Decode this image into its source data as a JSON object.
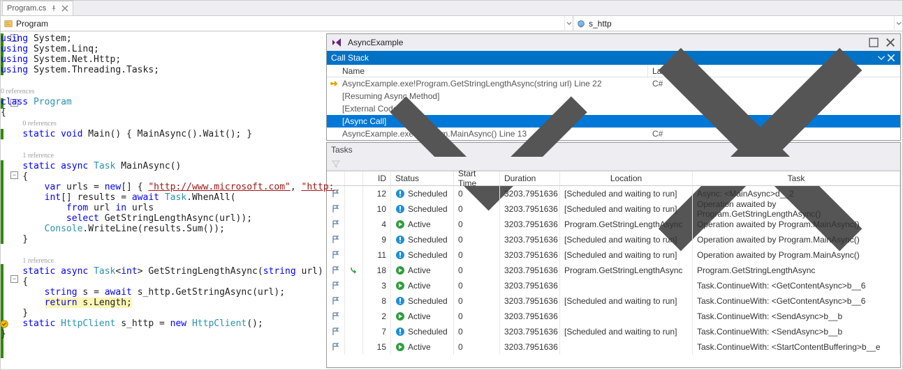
{
  "tab": {
    "title": "Program.cs"
  },
  "navbar": {
    "left": "Program",
    "right": "s_http"
  },
  "code": {
    "lines": [
      {
        "t": "using ",
        "k": true,
        "r": "System;"
      },
      {
        "t": "using ",
        "k": true,
        "r": "System.Linq;"
      },
      {
        "t": "using ",
        "k": true,
        "r": "System.Net.Http;"
      },
      {
        "t": "using ",
        "k": true,
        "r": "System.Threading.Tasks;"
      }
    ],
    "lens0": "0 references",
    "class_decl_kw": "class ",
    "class_decl_name": "Program",
    "lens1": "0 references",
    "main_sig_pre": "static void ",
    "main_sig_name": "Main() { MainAsync().Wait(); }",
    "lens2": "1 reference",
    "mainasync_pre": "static async ",
    "mainasync_type": "Task ",
    "mainasync_name": "MainAsync()",
    "urls_pre": "var ",
    "urls_mid": "urls = ",
    "urls_new": "new",
    "urls_rest": "[] { ",
    "url1": "\"http://www.microsoft.com\"",
    "urls_sep": ", ",
    "url2": "\"http:",
    "results_pre": "int",
    "results_mid": "[] results = ",
    "results_await": "await ",
    "results_type": "Task",
    "results_rest": ".WhenAll(",
    "from_pre": "from ",
    "from_mid": "url ",
    "from_in": "in ",
    "from_rest": "urls",
    "select_pre": "select ",
    "select_rest": "GetStringLengthAsync(url));",
    "console_type": "Console",
    "console_rest": ".WriteLine(results.Sum());",
    "lens3": "1 reference",
    "gsla_pre": "static async ",
    "gsla_type": "Task",
    "gsla_generic": "<",
    "gsla_int": "int",
    "gsla_rest": "> GetStringLengthAsync(",
    "gsla_str": "string ",
    "gsla_tail": "url)",
    "s_pre": "string ",
    "s_mid": "s = ",
    "s_await": "await ",
    "s_rest": "s_http.GetStringAsync(url);",
    "return_kw": "return ",
    "return_rest": "s.Length;",
    "httpclient_pre": "static ",
    "httpclient_type": "HttpClient ",
    "httpclient_mid": "s_http = ",
    "httpclient_new": "new ",
    "httpclient_type2": "HttpClient",
    "httpclient_rest": "();"
  },
  "asyncWindow": {
    "title": "AsyncExample",
    "callstack_title": "Call Stack",
    "col_name": "Name",
    "col_lang": "Language",
    "rows": [
      {
        "icon": "arrow",
        "name": "AsyncExample.exe!Program.GetStringLengthAsync(string url) Line 22",
        "lang": "C#"
      },
      {
        "icon": "",
        "name": "[Resuming Async Method]",
        "lang": ""
      },
      {
        "icon": "",
        "name": "[External Code]",
        "lang": ""
      },
      {
        "icon": "",
        "name": "[Async Call]",
        "lang": "",
        "sel": true
      },
      {
        "icon": "",
        "name": "AsyncExample.exe!Program.MainAsync() Line 13",
        "lang": "C#"
      }
    ]
  },
  "tasks": {
    "title": "Tasks",
    "cols": {
      "id": "ID",
      "status": "Status",
      "start": "Start Time",
      "dur": "Duration",
      "loc": "Location",
      "task": "Task"
    },
    "rows": [
      {
        "id": "12",
        "status": "Scheduled",
        "sicon": "sched",
        "start": "0",
        "dur": "3203.7951636",
        "loc": "[Scheduled and waiting to run]",
        "task": "Async: <MainAsync>d__2"
      },
      {
        "id": "10",
        "status": "Scheduled",
        "sicon": "sched",
        "start": "0",
        "dur": "3203.7951636",
        "loc": "[Scheduled and waiting to run]",
        "task": "Operation awaited by Program.GetStringLengthAsync()"
      },
      {
        "id": "4",
        "status": "Active",
        "sicon": "active",
        "start": "0",
        "dur": "3203.7951636",
        "loc": "Program.GetStringLengthAsync",
        "task": "Operation awaited by Program.MainAsync()"
      },
      {
        "id": "9",
        "status": "Scheduled",
        "sicon": "sched",
        "start": "0",
        "dur": "3203.7951636",
        "loc": "[Scheduled and waiting to run]",
        "task": "Operation awaited by Program.MainAsync()"
      },
      {
        "id": "11",
        "status": "Scheduled",
        "sicon": "sched",
        "start": "0",
        "dur": "3203.7951636",
        "loc": "[Scheduled and waiting to run]",
        "task": "Operation awaited by Program.MainAsync()"
      },
      {
        "id": "18",
        "status": "Active",
        "sicon": "active",
        "start": "0",
        "dur": "3203.7951636",
        "loc": "Program.GetStringLengthAsync",
        "task": "Program.GetStringLengthAsync",
        "arrow": true
      },
      {
        "id": "3",
        "status": "Active",
        "sicon": "active",
        "start": "0",
        "dur": "3203.7951636",
        "loc": "",
        "task": "Task.ContinueWith: <GetContentAsync>b__6"
      },
      {
        "id": "8",
        "status": "Scheduled",
        "sicon": "sched",
        "start": "0",
        "dur": "3203.7951636",
        "loc": "[Scheduled and waiting to run]",
        "task": "Task.ContinueWith: <GetContentAsync>b__6"
      },
      {
        "id": "2",
        "status": "Active",
        "sicon": "active",
        "start": "0",
        "dur": "3203.7951636",
        "loc": "",
        "task": "Task.ContinueWith: <SendAsync>b__b"
      },
      {
        "id": "7",
        "status": "Scheduled",
        "sicon": "sched",
        "start": "0",
        "dur": "3203.7951636",
        "loc": "[Scheduled and waiting to run]",
        "task": "Task.ContinueWith: <SendAsync>b__b"
      },
      {
        "id": "15",
        "status": "Active",
        "sicon": "active",
        "start": "0",
        "dur": "3203.7951636",
        "loc": "",
        "task": "Task.ContinueWith: <StartContentBuffering>b__e"
      }
    ]
  }
}
